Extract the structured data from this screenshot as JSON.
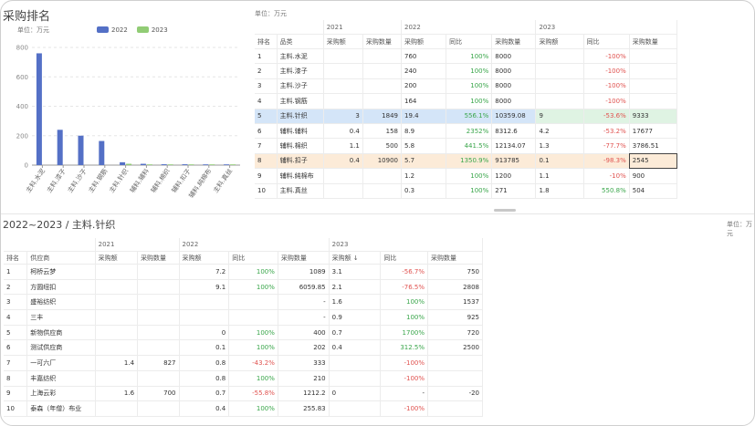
{
  "chart": {
    "title": "采购排名",
    "unit": "单位：万元",
    "legend": [
      {
        "name": "2022",
        "color": "#5470c6"
      },
      {
        "name": "2023",
        "color": "#91cc75"
      }
    ],
    "yticks": [
      "800",
      "600",
      "400",
      "200",
      "0"
    ]
  },
  "chart_data": {
    "type": "bar",
    "title": "采购排名",
    "ylabel": "单位：万元",
    "ylim": [
      0,
      800
    ],
    "categories": [
      "主料.水泥",
      "主料.漆子",
      "主料.沙子",
      "主料.钢筋",
      "主料.针织",
      "辅料.辅料",
      "辅料.棉织",
      "辅料.扣子",
      "辅料.純棉布",
      "主料.真丝"
    ],
    "series": [
      {
        "name": "2022",
        "values": [
          760,
          240,
          200,
          164,
          19.4,
          8.9,
          5.8,
          5.7,
          1.2,
          0.3
        ]
      },
      {
        "name": "2023",
        "values": [
          0,
          0,
          0,
          0,
          9,
          4.2,
          1.3,
          0.1,
          1.1,
          1.8
        ]
      }
    ],
    "legend_position": "top"
  },
  "table1": {
    "unit": "单位：万元",
    "years": [
      "2021",
      "2022",
      "2023"
    ],
    "headers": [
      "排名",
      "品类",
      "采购额",
      "采购数量",
      "采购额",
      "同比",
      "采购数量",
      "采购额",
      "同比",
      "采购数量"
    ],
    "rows": [
      [
        "1",
        "主料.水泥",
        "",
        "",
        "760",
        "100%",
        "8000",
        "",
        "-100%",
        ""
      ],
      [
        "2",
        "主料.漆子",
        "",
        "",
        "240",
        "100%",
        "8000",
        "",
        "-100%",
        ""
      ],
      [
        "3",
        "主料.沙子",
        "",
        "",
        "200",
        "100%",
        "8000",
        "",
        "-100%",
        ""
      ],
      [
        "4",
        "主料.钢筋",
        "",
        "",
        "164",
        "100%",
        "8000",
        "",
        "-100%",
        ""
      ],
      [
        "5",
        "主料.针织",
        "3",
        "1849",
        "19.4",
        "556.1%",
        "10359.08",
        "9",
        "-53.6%",
        "9333"
      ],
      [
        "6",
        "辅料.辅料",
        "0.4",
        "158",
        "8.9",
        "2352%",
        "8312.6",
        "4.2",
        "-53.2%",
        "17677"
      ],
      [
        "7",
        "辅料.棉织",
        "1.1",
        "500",
        "5.8",
        "441.5%",
        "12134.07",
        "1.3",
        "-77.7%",
        "3786.51"
      ],
      [
        "8",
        "辅料.扣子",
        "0.4",
        "10900",
        "5.7",
        "1350.9%",
        "913785",
        "0.1",
        "-98.3%",
        "2545"
      ],
      [
        "9",
        "辅料.純棉布",
        "",
        "",
        "1.2",
        "100%",
        "1200",
        "1.1",
        "-10%",
        "900"
      ],
      [
        "10",
        "主料.真丝",
        "",
        "",
        "0.3",
        "100%",
        "271",
        "1.8",
        "550.8%",
        "504"
      ]
    ]
  },
  "section2": {
    "title": "2022~2023 / 主料.针织",
    "unit": "单位：万元"
  },
  "table2": {
    "years": [
      "2021",
      "2022",
      "2023"
    ],
    "headers": [
      "排名",
      "供应商",
      "采购额",
      "采购数量",
      "采购额",
      "同比",
      "采购数量",
      "采购额 ↓",
      "同比",
      "采购数量"
    ],
    "rows": [
      [
        "1",
        "柯桥云梦",
        "",
        "",
        "7.2",
        "100%",
        "1089",
        "3.1",
        "-56.7%",
        "750"
      ],
      [
        "2",
        "方圆纽扣",
        "",
        "",
        "9.1",
        "100%",
        "6059.85",
        "2.1",
        "-76.5%",
        "2808"
      ],
      [
        "3",
        "盛裕纺织",
        "",
        "",
        "",
        "",
        "-",
        "1.6",
        "100%",
        "1537"
      ],
      [
        "4",
        "三丰",
        "",
        "",
        "",
        "",
        "-",
        "0.9",
        "100%",
        "925"
      ],
      [
        "5",
        "新物供应商",
        "",
        "",
        "0",
        "100%",
        "400",
        "0.7",
        "1700%",
        "720"
      ],
      [
        "6",
        "测试供应商",
        "",
        "",
        "0.1",
        "100%",
        "202",
        "0.4",
        "312.5%",
        "2500"
      ],
      [
        "7",
        "一可六厂",
        "1.4",
        "827",
        "0.8",
        "-43.2%",
        "333",
        "",
        "-100%",
        ""
      ],
      [
        "8",
        "丰嘉纺织",
        "",
        "",
        "0.8",
        "100%",
        "210",
        "",
        "-100%",
        ""
      ],
      [
        "9",
        "上海云彩",
        "1.6",
        "700",
        "0.7",
        "-55.8%",
        "1212.2",
        "0",
        "-",
        "-20"
      ],
      [
        "10",
        "泰森（年僧）布业",
        "",
        "",
        "0.4",
        "100%",
        "255.83",
        "",
        "-100%",
        ""
      ]
    ]
  }
}
